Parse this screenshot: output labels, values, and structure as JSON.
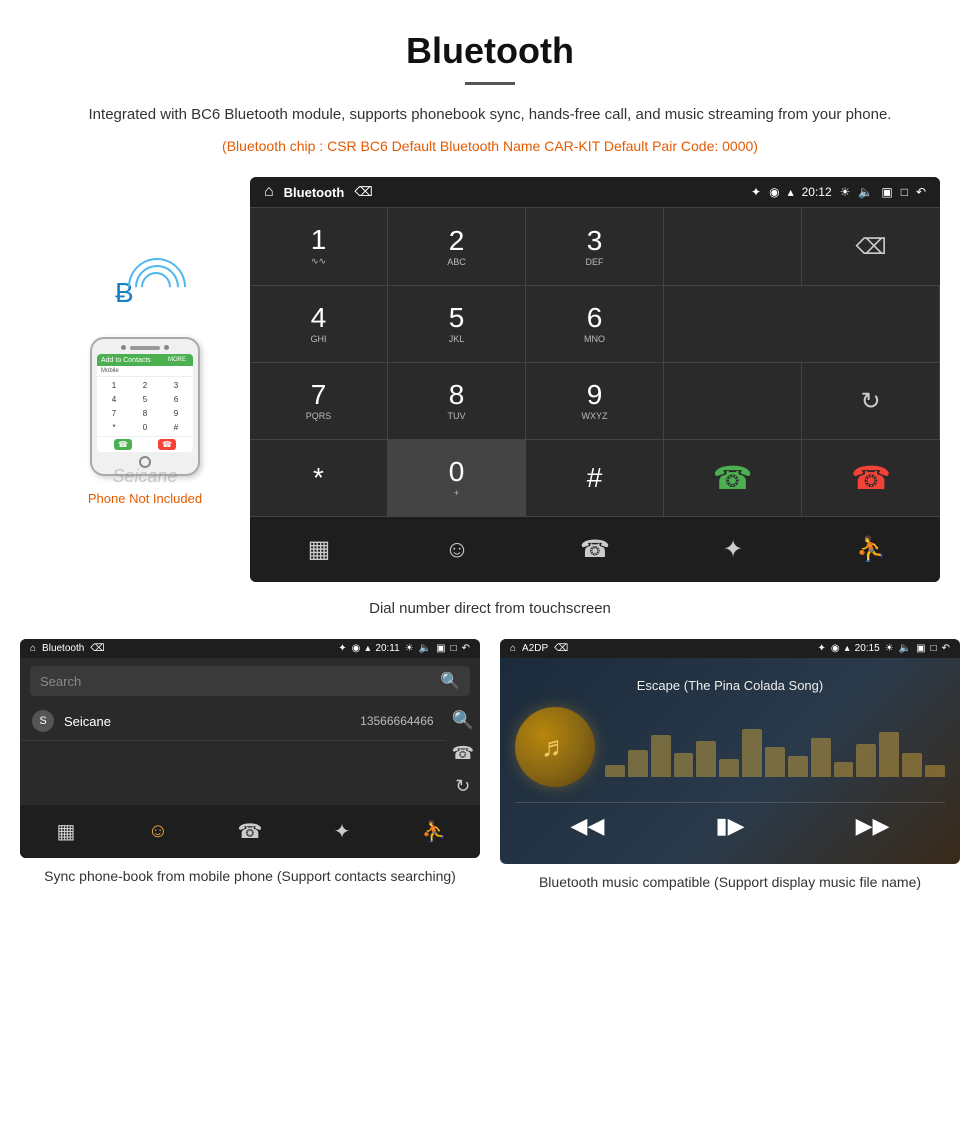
{
  "header": {
    "title": "Bluetooth",
    "description": "Integrated with BC6 Bluetooth module, supports phonebook sync, hands-free call, and music streaming from your phone.",
    "specs": "(Bluetooth chip : CSR BC6    Default Bluetooth Name CAR-KIT    Default Pair Code: 0000)"
  },
  "dial_screen": {
    "statusbar": {
      "app_title": "Bluetooth",
      "time": "20:12"
    },
    "keypad": [
      {
        "num": "1",
        "letters": "∿∿"
      },
      {
        "num": "2",
        "letters": "ABC"
      },
      {
        "num": "3",
        "letters": "DEF"
      },
      {
        "num": "4",
        "letters": "GHI"
      },
      {
        "num": "5",
        "letters": "JKL"
      },
      {
        "num": "6",
        "letters": "MNO"
      },
      {
        "num": "7",
        "letters": "PQRS"
      },
      {
        "num": "8",
        "letters": "TUV"
      },
      {
        "num": "9",
        "letters": "WXYZ"
      },
      {
        "num": "*",
        "letters": ""
      },
      {
        "num": "0",
        "letters": "+"
      },
      {
        "num": "#",
        "letters": ""
      }
    ],
    "caption": "Dial number direct from touchscreen"
  },
  "phonebook_screen": {
    "statusbar": {
      "app_title": "Bluetooth",
      "time": "20:11"
    },
    "search_placeholder": "Search",
    "contacts": [
      {
        "letter": "S",
        "name": "Seicane",
        "number": "13566664466"
      }
    ],
    "caption": "Sync phone-book from mobile phone\n(Support contacts searching)"
  },
  "music_screen": {
    "statusbar": {
      "app_title": "A2DP",
      "time": "20:15"
    },
    "track_title": "Escape (The Pina Colada Song)",
    "caption": "Bluetooth music compatible\n(Support display music file name)"
  },
  "phone_area": {
    "not_included_text": "Phone Not Included",
    "watermark": "Seicane"
  }
}
